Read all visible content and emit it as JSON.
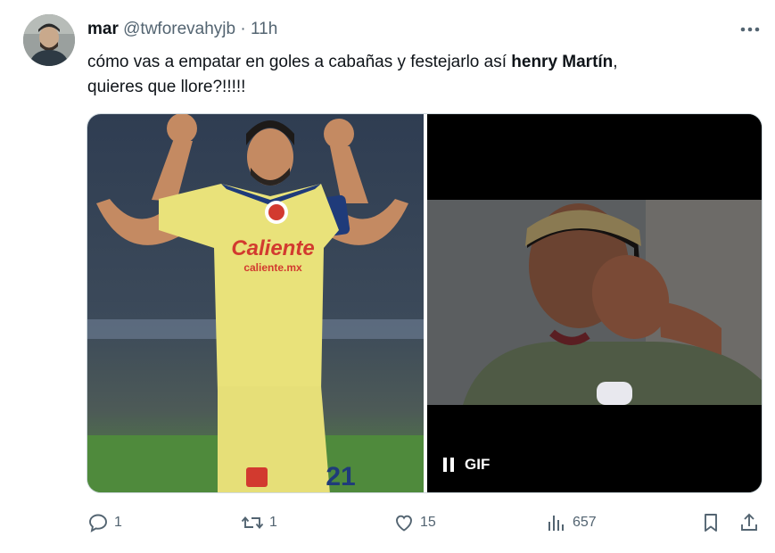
{
  "user": {
    "name": "mar",
    "handle": "@twforevahyjb",
    "separator": "·",
    "time": "11h"
  },
  "tweet": {
    "text_part1": "cómo vas a empatar en goles a cabañas y festejarlo así ",
    "text_bold": "henry Martín",
    "text_part2": ",",
    "text_line2": "quieres que llore?!!!!!"
  },
  "media": {
    "left_image": {
      "jersey_brand": "Caliente",
      "jersey_sub": "caliente.mx",
      "number": "21"
    },
    "gif": {
      "label": "GIF",
      "state": "playing"
    }
  },
  "actions": {
    "replies": "1",
    "retweets": "1",
    "likes": "15",
    "views": "657"
  },
  "colors": {
    "text": "#0f1419",
    "muted": "#536471",
    "jersey_yellow": "#e9e27a",
    "pitch_green": "#4f8a3c"
  }
}
